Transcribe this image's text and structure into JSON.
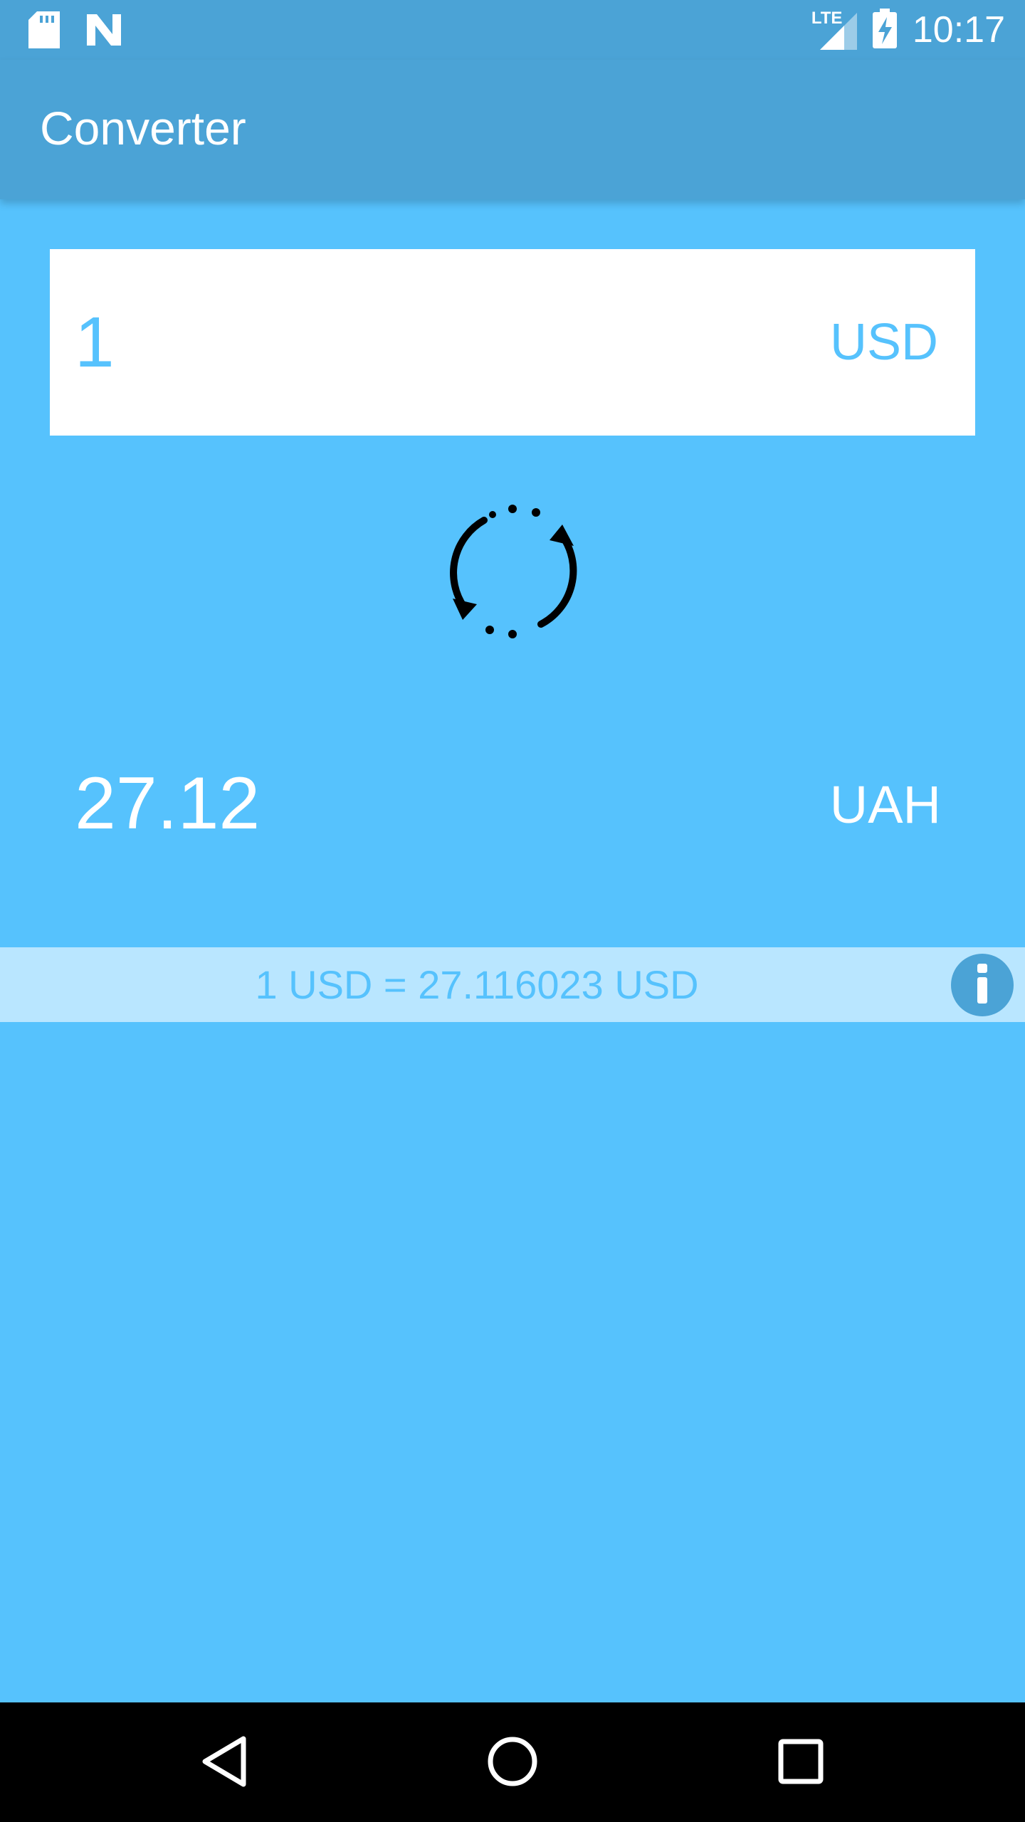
{
  "status_bar": {
    "time": "10:17",
    "network_label": "LTE",
    "icons": [
      "sd-card-icon",
      "n-notification-icon",
      "signal-icon",
      "battery-charging-icon"
    ]
  },
  "app_bar": {
    "title": "Converter"
  },
  "input": {
    "amount": "1",
    "currency": "USD"
  },
  "swap_button": {
    "icon": "swap-refresh-icon"
  },
  "result": {
    "amount": "27.12",
    "currency": "UAH"
  },
  "rate": {
    "text": "1 USD = 27.116023 USD",
    "info_icon": "info-icon"
  },
  "nav_bar": {
    "icons": [
      "back-icon",
      "home-icon",
      "recents-icon"
    ]
  },
  "colors": {
    "background": "#56C2FD",
    "app_bar": "#4BA3D6",
    "rate_bar": "#B9E6FF",
    "accent_text": "#56C2FD"
  }
}
